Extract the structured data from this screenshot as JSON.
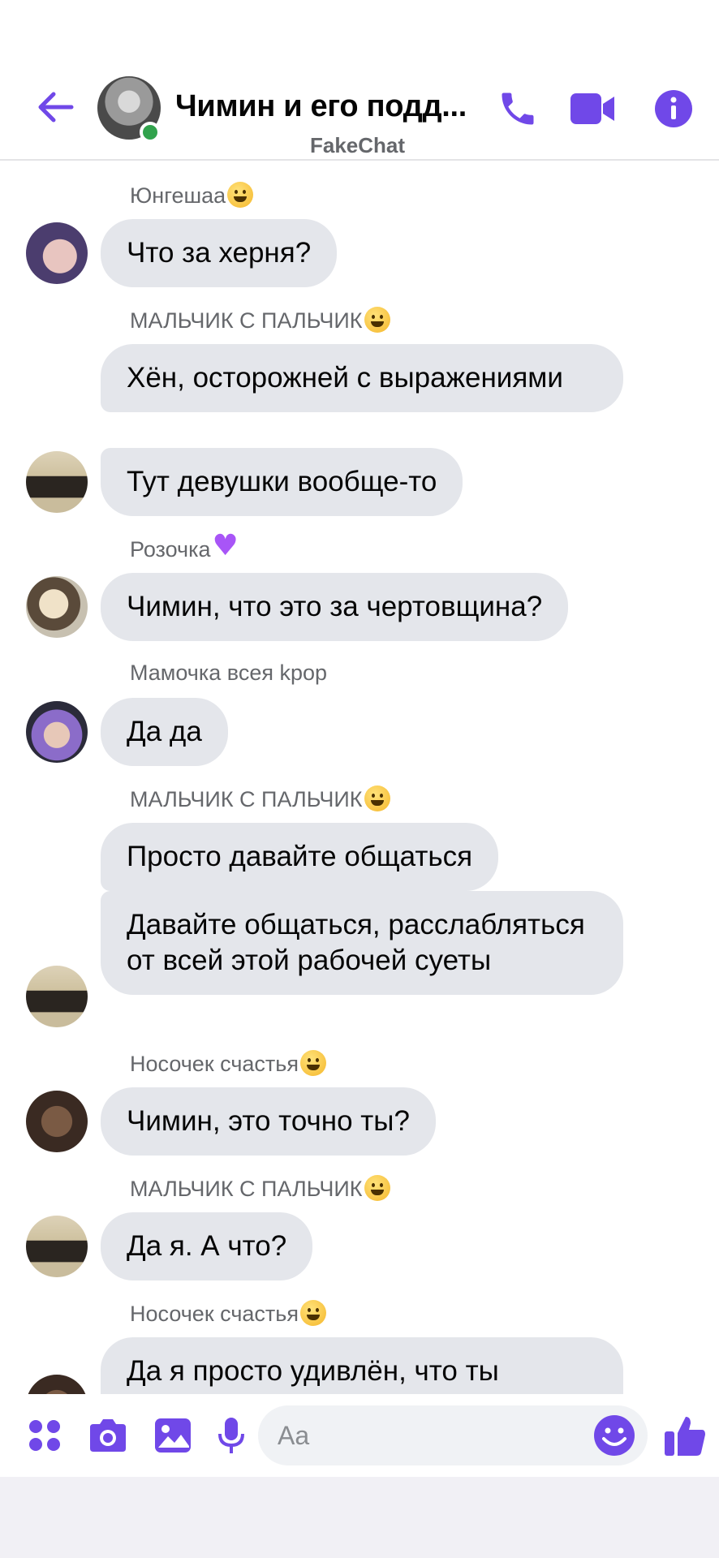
{
  "header": {
    "title": "Чимин и его подд...",
    "subtitle": "FakeChat",
    "accent_color": "#7048e8",
    "icons": [
      "back-arrow-icon",
      "phone-icon",
      "video-camera-icon",
      "info-icon"
    ]
  },
  "messages": [
    {
      "sender": "Юнгешаа",
      "sender_emoji": "zany-face",
      "texts": [
        "Что за херня?"
      ]
    },
    {
      "sender": "МАЛЬЧИК С ПАЛЬЧИК",
      "sender_emoji": "grinning-face",
      "texts": [
        "Хён, осторожней с выражениями",
        "Тут девушки вообще-то"
      ]
    },
    {
      "sender": "Розочка",
      "sender_emoji": "purple-heart",
      "texts": [
        "Чимин, что это за чертовщина?"
      ]
    },
    {
      "sender": "Мамочка всея kpop",
      "sender_emoji": "",
      "texts": [
        "Да да"
      ]
    },
    {
      "sender": "МАЛЬЧИК С ПАЛЬЧИК",
      "sender_emoji": "grinning-face",
      "texts": [
        "Просто давайте общаться",
        "Давайте общаться, расслабляться от всей этой рабочей суеты"
      ]
    },
    {
      "sender": "Носочек счастья",
      "sender_emoji": "kissing-face",
      "texts": [
        "Чимин, это точно ты?"
      ]
    },
    {
      "sender": "МАЛЬЧИК С ПАЛЬЧИК",
      "sender_emoji": "grinning-face",
      "texts": [
        "Да я. А что?"
      ]
    },
    {
      "sender": "Носочек счастья",
      "sender_emoji": "kissing-face",
      "texts": [
        "Да  я просто удивлён, что ты"
      ]
    }
  ],
  "composer": {
    "placeholder": "Aa",
    "icons": [
      "apps-grid-icon",
      "camera-icon",
      "gallery-icon",
      "microphone-icon",
      "emoji-icon",
      "thumbs-up-icon"
    ]
  }
}
